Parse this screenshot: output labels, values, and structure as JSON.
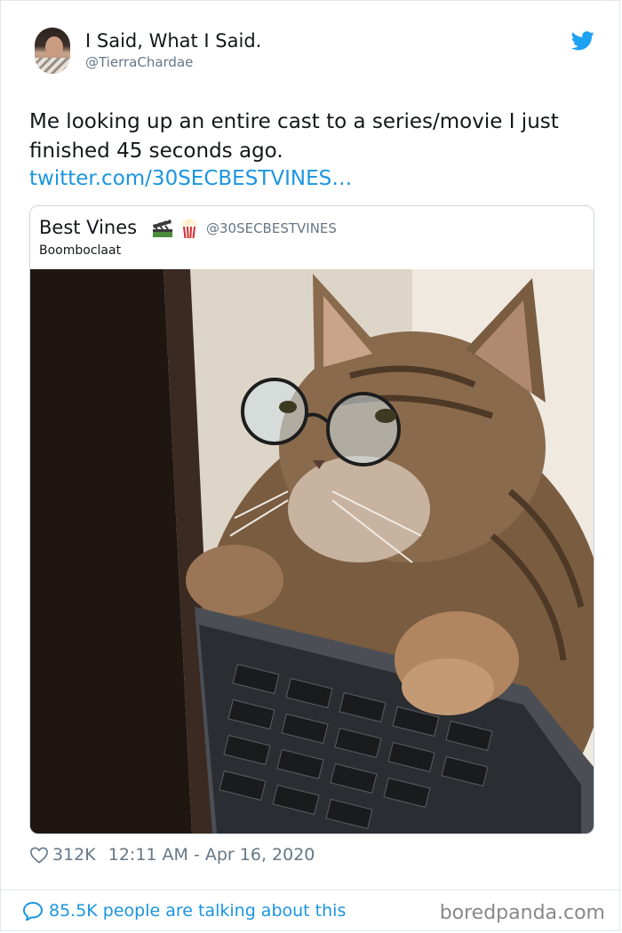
{
  "tweet": {
    "author_name": "I Said, What I Said.",
    "author_handle": "@TierraChardae",
    "text": "Me looking up an entire cast to a series/movie I just finished 45 seconds ago.",
    "link": "twitter.com/30SECBESTVINES…",
    "likes": "312K",
    "timestamp": "12:11 AM - Apr 16, 2020",
    "talking": "85.5K people are talking about this"
  },
  "quoted": {
    "name": "Best Vines",
    "handle": "@30SECBESTVINES",
    "text": "Boomboclaat"
  },
  "icons": {
    "bird": "twitter-bird-icon",
    "heart": "heart-icon",
    "bubble": "speech-bubble-icon",
    "clapper": "clapper-board-icon",
    "popcorn": "popcorn-icon"
  },
  "colors": {
    "link_blue": "#1b95e0",
    "muted_gray": "#657786",
    "border": "#e1e8ed"
  },
  "watermark": "boredpanda.com"
}
